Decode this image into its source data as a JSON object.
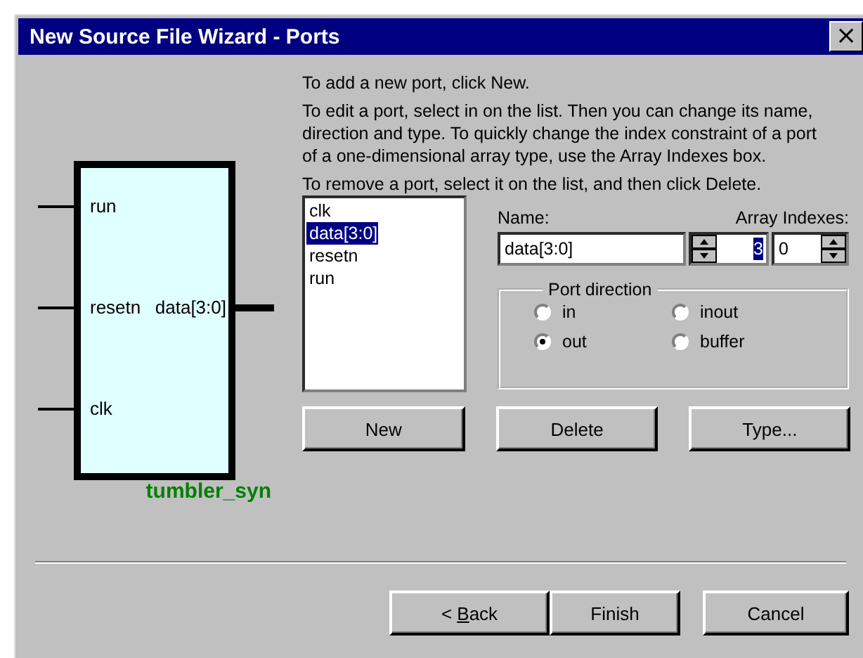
{
  "window": {
    "title": "New Source File Wizard - Ports",
    "close": "×"
  },
  "diagram": {
    "entity": "tumbler_syn",
    "inputs": [
      "run",
      "resetn",
      "clk"
    ],
    "outputs": [
      "data[3:0]"
    ]
  },
  "instructions": [
    "To add a new port, click New.",
    "To edit a port, select in on the list. Then you can change its name, direction and type. To quickly change the index constraint of a port of a one-dimensional array type, use the Array Indexes box.",
    "To remove a port, select it on the list, and then click Delete."
  ],
  "ports": [
    {
      "label": "clk",
      "selected": false
    },
    {
      "label": "data[3:0]",
      "selected": true
    },
    {
      "label": "resetn",
      "selected": false
    },
    {
      "label": "run",
      "selected": false
    }
  ],
  "name_label": "Name:",
  "name_value": "data[3:0]",
  "array_label": "Array Indexes:",
  "index_high": "3",
  "index_low": "0",
  "direction": {
    "title": "Port direction",
    "options": [
      {
        "label": "in",
        "selected": false
      },
      {
        "label": "inout",
        "selected": false
      },
      {
        "label": "out",
        "selected": true
      },
      {
        "label": "buffer",
        "selected": false
      }
    ]
  },
  "list_buttons": [
    "New",
    "Delete",
    "Type..."
  ],
  "nav_buttons": [
    {
      "label_parts": [
        "< ",
        "B",
        "ack"
      ]
    },
    {
      "label_parts": [
        "Finish"
      ]
    },
    {
      "label_parts": [
        "Cancel"
      ]
    }
  ]
}
